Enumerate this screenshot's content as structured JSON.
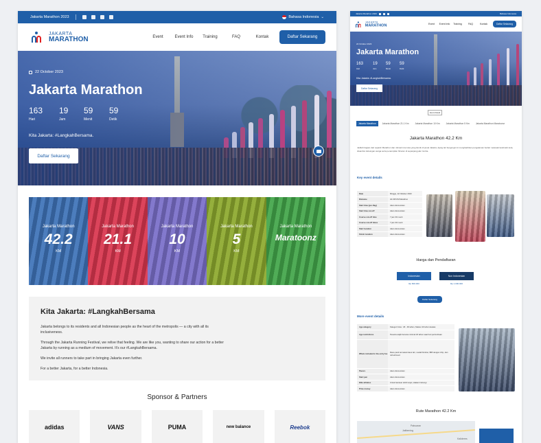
{
  "colors": {
    "brand": "#1f5fa8",
    "accent_red": "#e02020"
  },
  "left": {
    "topbar": {
      "title": "Jakarta Marathon 2023",
      "language": "Bahasa Indonesia",
      "social_icons": [
        "facebook-icon",
        "twitter-icon",
        "youtube-icon",
        "instagram-icon"
      ]
    },
    "logo": {
      "line1": "JAKARTA",
      "line2": "MARATHON"
    },
    "nav": {
      "items": [
        "Event",
        "Event Info",
        "Training",
        "FAQ",
        "Kontak"
      ],
      "cta": "Daftar Sekarang"
    },
    "hero": {
      "date": "22 October 2023",
      "title": "Jakarta Marathon",
      "countdown": [
        {
          "value": "163",
          "label": "Hari"
        },
        {
          "value": "19",
          "label": "Jam"
        },
        {
          "value": "59",
          "label": "Menit"
        },
        {
          "value": "59",
          "label": "Detik"
        }
      ],
      "tagline": "Kita Jakarta: #LangkahBersama.",
      "button": "Daftar Sekarang"
    },
    "categories": [
      {
        "title": "Jakarta Marathon",
        "value": "42.2",
        "unit": "KM",
        "color": "#3f73b8"
      },
      {
        "title": "Jakarta Marathon",
        "value": "21.1",
        "unit": "KM",
        "color": "#d9364f"
      },
      {
        "title": "Jakarta Marathon",
        "value": "10",
        "unit": "KM",
        "color": "#7a6fc9"
      },
      {
        "title": "Jakarta Marathon",
        "value": "5",
        "unit": "KM",
        "color": "#8da92e"
      },
      {
        "title": "Jakarta Marathon",
        "value": "Maratoonz",
        "unit": "",
        "color": "#43a64a"
      }
    ],
    "about": {
      "heading": "Kita Jakarta: #LangkahBersama",
      "paragraphs": [
        "Jakarta belongs to its residents and all Indonesian people as the heart of the metropolis — a city with all its inclusiveness.",
        "Through the Jakarta Running Festival, we relive that feeling. We are like you, wanting to share our action for a better Jakarta by running as a medium of movement. It's our #LangkahBersama.",
        "We invite all runners to take part in bringing Jakarta even further.",
        "For a better Jakarta, for a better Indonesia."
      ]
    },
    "sponsors": {
      "heading": "Sponsor & Partners",
      "logos": [
        "adidas",
        "VANS",
        "PUMA",
        "new balance",
        "Reebok"
      ]
    }
  },
  "right": {
    "topbar": {
      "title": "Jakarta Marathon 2023",
      "language": "Bahasa Indonesia"
    },
    "logo": {
      "line1": "JAKARTA",
      "line2": "MARATHON"
    },
    "nav": {
      "items": [
        "Event",
        "Event Info",
        "Training",
        "FAQ",
        "Kontak"
      ],
      "cta": "Daftar Sekarang"
    },
    "hero": {
      "date": "22 October 2023",
      "title": "Jakarta Marathon",
      "countdown": [
        {
          "value": "163",
          "label": "Hari"
        },
        {
          "value": "19",
          "label": "Jam"
        },
        {
          "value": "59",
          "label": "Menit"
        },
        {
          "value": "59",
          "label": "Detik"
        }
      ],
      "tagline": "Kita Jakarta: #LangkahBersama.",
      "button": "Daftar Sekarang"
    },
    "small_button": "Event Detail",
    "tabs": [
      "Jakarta Marathon",
      "Jakarta Marathon 21.1 Km",
      "Jakarta Marathon 10 Km",
      "Jakarta Marathon 5 Km",
      "Jakarta Marathon Maratoonz"
    ],
    "section_title": "Jakarta Marathon 42.2 Km",
    "intro": "Jadilah bagian dari sejarah Marathon dan nikmati rute kota yang ikonik di pusat Jakarta. Ajang lari bergengsi ini menghadirkan pengalaman berlari melewati landmark kota, disambut dukungan warga serta penampilan hiburan di sepanjang jalur lomba.",
    "key_details": {
      "heading": "Key event details",
      "rows": [
        {
          "k": "Date",
          "v": "Minggu, 22 Oktober 2023"
        },
        {
          "k": "Distance",
          "v": "42.195 KM Marathon"
        },
        {
          "k": "Start time (pre-flag)",
          "v": "Akan diumumkan"
        },
        {
          "k": "Start time cut-off",
          "v": "Akan diumumkan"
        },
        {
          "k": "Course cut-off time",
          "v": "7 jam 30 menit"
        },
        {
          "k": "Course cut-off times",
          "v": "7 jam 30 menit"
        },
        {
          "k": "Start location",
          "v": "Akan diumumkan"
        },
        {
          "k": "Finish location",
          "v": "Akan diumumkan"
        }
      ]
    },
    "pricing": {
      "heading": "Harga dan Pendaftaran",
      "options": [
        {
          "label": "Indonesian",
          "price": "Rp 800.000",
          "color": "#1f5fa8"
        },
        {
          "label": "Non Indonesian",
          "price": "Rp 1.000.000",
          "color": "#163a66"
        }
      ],
      "button": "Daftar Sekarang"
    },
    "more_details": {
      "heading": "More event details",
      "rows": [
        {
          "k": "Age category",
          "v": "Kategori Usia : 18 - 39 tahun, Master 40 tahun keatas"
        },
        {
          "k": "Age restrictions",
          "v": "Peserta wajib berusia minimal 18 tahun saat hari perlombaan"
        },
        {
          "k": "Whats included in the entry fee",
          "v": "Race pack termasuk kaos lari, medali finisher, BIB dengan chip, dan refreshment"
        },
        {
          "k": "Pacers",
          "v": "Akan diumumkan"
        },
        {
          "k": "Start pen",
          "v": "Akan diumumkan"
        },
        {
          "k": "Elite athletes",
          "v": "Untuk bantuan lebih lanjut, silakan hubungi"
        },
        {
          "k": "Prize money",
          "v": "Akan diumumkan"
        }
      ]
    },
    "route_heading": "Rute Marathon 42.2 Km",
    "map_labels": [
      "Pabuaran",
      "Jatibening",
      "Kalideres"
    ]
  }
}
